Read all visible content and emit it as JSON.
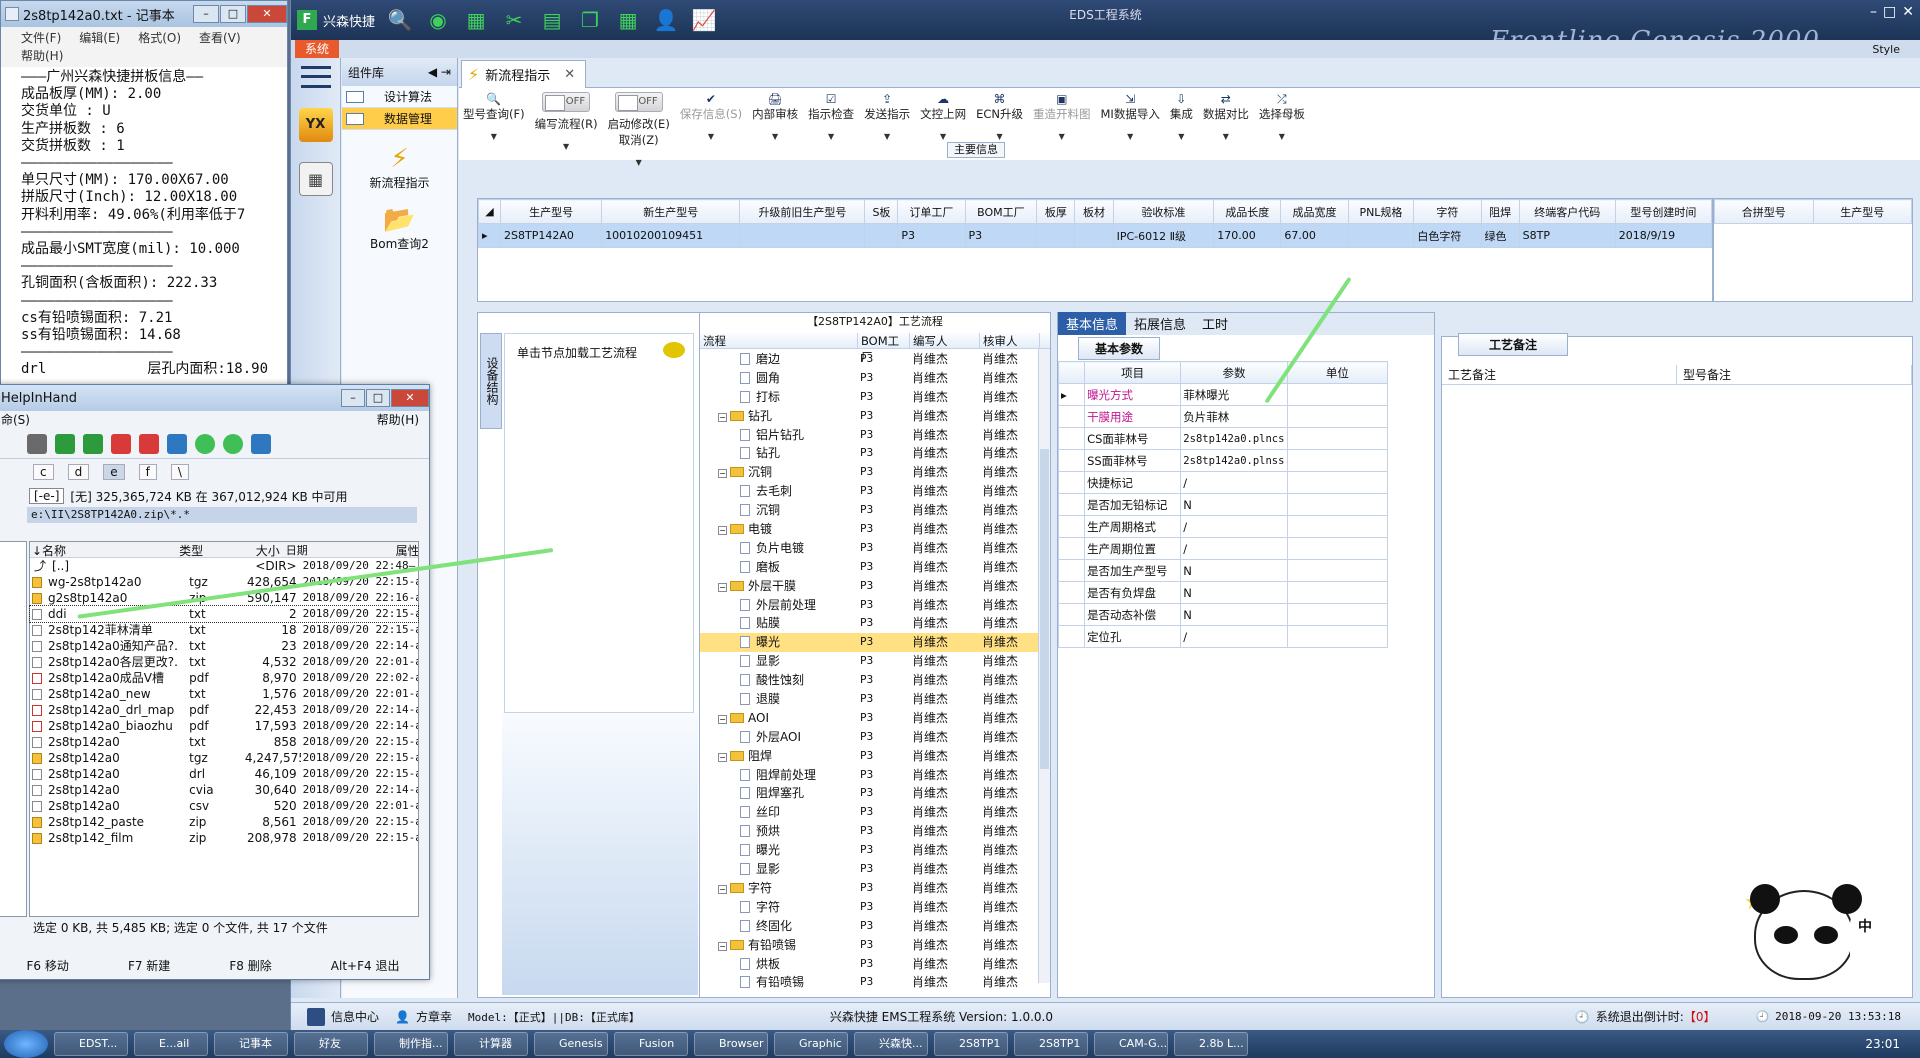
{
  "notepad": {
    "title": "2s8tp142a0.txt - 记事本",
    "menu": [
      "文件(F)",
      "编辑(E)",
      "格式(O)",
      "查看(V)",
      "帮助(H)"
    ],
    "lines": [
      "———广州兴森快捷拼板信息——",
      "成品板厚(MM): 2.00",
      "交货单位 : U",
      "生产拼板数 : 6",
      "交货拼板数 : 1",
      "——————————————————",
      "单只尺寸(MM): 170.00X67.00",
      "拼版尺寸(Inch): 12.00X18.00",
      "开料利用率: 49.06%(利用率低于7",
      "——————————————————",
      "成品最小SMT宽度(mil): 10.000",
      "——————————————————",
      "孔铜面积(含板面积): 222.33",
      "",
      "——————————————————",
      "cs有铅喷锡面积: 7.21",
      "ss有铅喷锡面积: 14.68",
      "——————————————————",
      "drl            层孔内面积:18.90"
    ]
  },
  "app": {
    "brand": "兴森快捷",
    "window_title": "EDS工程系统",
    "banner": "Frontline  Genesis 2000",
    "style_label": "Style",
    "system_tab": "系统",
    "quick_icons": [
      "search-icon",
      "globe-icon",
      "grid-icon",
      "scissors-icon",
      "film-icon",
      "copy-icon",
      "table-icon",
      "user-icon",
      "chart-icon"
    ]
  },
  "complib": {
    "title": "组件库",
    "items": [
      {
        "label": "设计算法"
      },
      {
        "label": "数据管理"
      }
    ],
    "big_items": [
      {
        "label": "新流程指示"
      },
      {
        "label": "Bom查询2"
      }
    ]
  },
  "doc_tab": {
    "label": "新流程指示"
  },
  "toolbar": {
    "buttons": [
      {
        "label": "型号查询(F)",
        "icon": "search-icon"
      },
      {
        "label": "编写流程(R)",
        "toggle": "OFF"
      },
      {
        "label": "启动修改(E)",
        "toggle": "OFF",
        "sub": "取消(Z)"
      },
      {
        "label": "保存信息(S)",
        "icon": "check-icon",
        "disabled": true
      },
      {
        "label": "内部审核",
        "icon": "printer-icon"
      },
      {
        "label": "指示检查",
        "icon": "checklist-icon"
      },
      {
        "label": "发送指示",
        "icon": "upload-icon"
      },
      {
        "label": "文控上网",
        "icon": "cloud-upload-icon"
      },
      {
        "label": "ECN升级",
        "icon": "binoculars-icon"
      },
      {
        "label": "重造开料图",
        "icon": "image-icon",
        "disabled": true
      },
      {
        "label": "MI数据导入",
        "icon": "import-icon"
      },
      {
        "label": "集成",
        "icon": "download-icon"
      },
      {
        "label": "数据对比",
        "icon": "compare-icon"
      },
      {
        "label": "选择母板",
        "icon": "shuffle-icon"
      }
    ]
  },
  "main_info": {
    "section_title": "主要信息",
    "columns": [
      "生产型号",
      "新生产型号",
      "升级前旧生产型号",
      "S板",
      "订单工厂",
      "BOM工厂",
      "板厚",
      "板材",
      "验收标准",
      "成品长度",
      "成品宽度",
      "PNL规格",
      "字符",
      "阻焊",
      "终端客户代码",
      "型号创建时间"
    ],
    "rows": [
      [
        "2S8TP142A0",
        "10010200109451",
        "",
        "",
        "P3",
        "P3",
        "",
        "",
        "IPC-6012 Ⅱ级",
        "170.00",
        "67.00",
        "",
        "白色字符",
        "绿色",
        "S8TP",
        "2018/9/19"
      ]
    ],
    "merge_columns": [
      "合拼型号",
      "生产型号"
    ]
  },
  "process": {
    "vtab": "设备结构",
    "hint": "单击节点加载工艺流程",
    "title": "【2S8TP142A0】工艺流程",
    "columns": [
      "流程",
      "BOM工厂",
      "编写人",
      "核审人"
    ],
    "rows": [
      {
        "name": "磨边",
        "level": 2,
        "bom": "P3",
        "writer": "肖维杰",
        "reviewer": "肖维杰"
      },
      {
        "name": "圆角",
        "level": 2,
        "bom": "P3",
        "writer": "肖维杰",
        "reviewer": "肖维杰"
      },
      {
        "name": "打标",
        "level": 2,
        "bom": "P3",
        "writer": "肖维杰",
        "reviewer": "肖维杰"
      },
      {
        "name": "钻孔",
        "level": 1,
        "bom": "P3",
        "writer": "肖维杰",
        "reviewer": "肖维杰"
      },
      {
        "name": "铝片钻孔",
        "level": 2,
        "bom": "P3",
        "writer": "肖维杰",
        "reviewer": "肖维杰"
      },
      {
        "name": "钻孔",
        "level": 2,
        "bom": "P3",
        "writer": "肖维杰",
        "reviewer": "肖维杰"
      },
      {
        "name": "沉铜",
        "level": 1,
        "bom": "P3",
        "writer": "肖维杰",
        "reviewer": "肖维杰"
      },
      {
        "name": "去毛刺",
        "level": 2,
        "bom": "P3",
        "writer": "肖维杰",
        "reviewer": "肖维杰"
      },
      {
        "name": "沉铜",
        "level": 2,
        "bom": "P3",
        "writer": "肖维杰",
        "reviewer": "肖维杰"
      },
      {
        "name": "电镀",
        "level": 1,
        "bom": "P3",
        "writer": "肖维杰",
        "reviewer": "肖维杰"
      },
      {
        "name": "负片电镀",
        "level": 2,
        "bom": "P3",
        "writer": "肖维杰",
        "reviewer": "肖维杰"
      },
      {
        "name": "磨板",
        "level": 2,
        "bom": "P3",
        "writer": "肖维杰",
        "reviewer": "肖维杰"
      },
      {
        "name": "外层干膜",
        "level": 1,
        "bom": "P3",
        "writer": "肖维杰",
        "reviewer": "肖维杰"
      },
      {
        "name": "外层前处理",
        "level": 2,
        "bom": "P3",
        "writer": "肖维杰",
        "reviewer": "肖维杰"
      },
      {
        "name": "贴膜",
        "level": 2,
        "bom": "P3",
        "writer": "肖维杰",
        "reviewer": "肖维杰"
      },
      {
        "name": "曝光",
        "level": 2,
        "bom": "P3",
        "writer": "肖维杰",
        "reviewer": "肖维杰",
        "selected": true
      },
      {
        "name": "显影",
        "level": 2,
        "bom": "P3",
        "writer": "肖维杰",
        "reviewer": "肖维杰"
      },
      {
        "name": "酸性蚀刻",
        "level": 2,
        "bom": "P3",
        "writer": "肖维杰",
        "reviewer": "肖维杰"
      },
      {
        "name": "退膜",
        "level": 2,
        "bom": "P3",
        "writer": "肖维杰",
        "reviewer": "肖维杰"
      },
      {
        "name": "AOI",
        "level": 1,
        "bom": "P3",
        "writer": "肖维杰",
        "reviewer": "肖维杰"
      },
      {
        "name": "外层AOI",
        "level": 2,
        "bom": "P3",
        "writer": "肖维杰",
        "reviewer": "肖维杰"
      },
      {
        "name": "阻焊",
        "level": 1,
        "bom": "P3",
        "writer": "肖维杰",
        "reviewer": "肖维杰"
      },
      {
        "name": "阻焊前处理",
        "level": 2,
        "bom": "P3",
        "writer": "肖维杰",
        "reviewer": "肖维杰"
      },
      {
        "name": "阻焊塞孔",
        "level": 2,
        "bom": "P3",
        "writer": "肖维杰",
        "reviewer": "肖维杰"
      },
      {
        "name": "丝印",
        "level": 2,
        "bom": "P3",
        "writer": "肖维杰",
        "reviewer": "肖维杰"
      },
      {
        "name": "预烘",
        "level": 2,
        "bom": "P3",
        "writer": "肖维杰",
        "reviewer": "肖维杰"
      },
      {
        "name": "曝光",
        "level": 2,
        "bom": "P3",
        "writer": "肖维杰",
        "reviewer": "肖维杰"
      },
      {
        "name": "显影",
        "level": 2,
        "bom": "P3",
        "writer": "肖维杰",
        "reviewer": "肖维杰"
      },
      {
        "name": "字符",
        "level": 1,
        "bom": "P3",
        "writer": "肖维杰",
        "reviewer": "肖维杰"
      },
      {
        "name": "字符",
        "level": 2,
        "bom": "P3",
        "writer": "肖维杰",
        "reviewer": "肖维杰"
      },
      {
        "name": "终固化",
        "level": 2,
        "bom": "P3",
        "writer": "肖维杰",
        "reviewer": "肖维杰"
      },
      {
        "name": "有铅喷锡",
        "level": 1,
        "bom": "P3",
        "writer": "肖维杰",
        "reviewer": "肖维杰"
      },
      {
        "name": "烘板",
        "level": 2,
        "bom": "P3",
        "writer": "肖维杰",
        "reviewer": "肖维杰"
      },
      {
        "name": "有铅喷锡",
        "level": 2,
        "bom": "P3",
        "writer": "肖维杰",
        "reviewer": "肖维杰"
      }
    ]
  },
  "basic": {
    "tabs": [
      "基本信息",
      "拓展信息",
      "工时"
    ],
    "sub_title": "基本参数",
    "columns": [
      "项目",
      "参数",
      "单位"
    ],
    "rows": [
      {
        "item": "曝光方式",
        "value": "菲林曝光",
        "hl": true
      },
      {
        "item": "干膜用途",
        "value": "负片菲林",
        "hl": true
      },
      {
        "item": "CS面菲林号",
        "value": "2s8tp142a0.plncs"
      },
      {
        "item": "SS面菲林号",
        "value": "2s8tp142a0.plnss"
      },
      {
        "item": "快捷标记",
        "value": "/"
      },
      {
        "item": "是否加无铅标记",
        "value": "N"
      },
      {
        "item": "生产周期格式",
        "value": "/"
      },
      {
        "item": "生产周期位置",
        "value": "/"
      },
      {
        "item": "是否加生产型号",
        "value": "N"
      },
      {
        "item": "是否有负焊盘",
        "value": "N"
      },
      {
        "item": "是否动态补偿",
        "value": "N"
      },
      {
        "item": "定位孔",
        "value": "/"
      }
    ]
  },
  "notes": {
    "title": "工艺备注",
    "columns": [
      "工艺备注",
      "型号备注"
    ]
  },
  "status": {
    "info_center": "信息中心",
    "user": "方章幸",
    "model": "Model:【正式】||DB:【正式库】",
    "system": "兴森快捷 EMS工程系统 Version: 1.0.0.0",
    "logout_label": "系统退出倒计时:",
    "logout_value": "【0】",
    "datetime": "2018-09-20 13:53:18"
  },
  "hih": {
    "title": "HelpInHand",
    "menu_left": "命(S)",
    "menu_right": "帮助(H)",
    "drives": [
      "c",
      "d",
      "e",
      "f",
      "\\"
    ],
    "drive_select": "[-e-]",
    "space": "[无] 325,365,724 KB 在 367,012,924 KB 中可用",
    "path": "e:\\II\\2S8TP142A0.zip\\*.*",
    "columns": [
      "↓名称",
      "类型",
      "大小",
      "日期",
      "属性"
    ],
    "files": [
      {
        "name": "[..]",
        "type": "",
        "size": "<DIR>",
        "date": "2018/09/20 22:48—",
        "kind": "up"
      },
      {
        "name": "wg-2s8tp142a0",
        "type": "tgz",
        "size": "428,654",
        "date": "2018/09/20 22:15-a—",
        "kind": "arc"
      },
      {
        "name": "g2s8tp142a0",
        "type": "zip",
        "size": "590,147",
        "date": "2018/09/20 22:16-a—",
        "kind": "arc"
      },
      {
        "name": "ddi",
        "type": "txt",
        "size": "2",
        "date": "2018/09/20 22:15-a—",
        "kind": "doc",
        "selected": true
      },
      {
        "name": "2s8tp142菲林清单",
        "type": "txt",
        "size": "18",
        "date": "2018/09/20 22:15-a—",
        "kind": "doc"
      },
      {
        "name": "2s8tp142a0通知产品?.",
        "type": "txt",
        "size": "23",
        "date": "2018/09/20 22:14-a—",
        "kind": "doc"
      },
      {
        "name": "2s8tp142a0各层更改?.",
        "type": "txt",
        "size": "4,532",
        "date": "2018/09/20 22:01-a—",
        "kind": "doc"
      },
      {
        "name": "2s8tp142a0成品V槽",
        "type": "pdf",
        "size": "8,970",
        "date": "2018/09/20 22:02-a—",
        "kind": "pdf"
      },
      {
        "name": "2s8tp142a0_new",
        "type": "txt",
        "size": "1,576",
        "date": "2018/09/20 22:01-a—",
        "kind": "doc"
      },
      {
        "name": "2s8tp142a0_drl_map",
        "type": "pdf",
        "size": "22,453",
        "date": "2018/09/20 22:14-a—",
        "kind": "pdf"
      },
      {
        "name": "2s8tp142a0_biaozhu",
        "type": "pdf",
        "size": "17,593",
        "date": "2018/09/20 22:14-a—",
        "kind": "pdf"
      },
      {
        "name": "2s8tp142a0",
        "type": "txt",
        "size": "858",
        "date": "2018/09/20 22:15-a—",
        "kind": "doc"
      },
      {
        "name": "2s8tp142a0",
        "type": "tgz",
        "size": "4,247,575",
        "date": "2018/09/20 22:15-a—",
        "kind": "arc"
      },
      {
        "name": "2s8tp142a0",
        "type": "drl",
        "size": "46,109",
        "date": "2018/09/20 22:15-a—",
        "kind": "doc"
      },
      {
        "name": "2s8tp142a0",
        "type": "cvia",
        "size": "30,640",
        "date": "2018/09/20 22:14-a—",
        "kind": "doc"
      },
      {
        "name": "2s8tp142a0",
        "type": "csv",
        "size": "520",
        "date": "2018/09/20 22:01-a—",
        "kind": "doc"
      },
      {
        "name": "2s8tp142_paste",
        "type": "zip",
        "size": "8,561",
        "date": "2018/09/20 22:15-a—",
        "kind": "arc"
      },
      {
        "name": "2s8tp142_film",
        "type": "zip",
        "size": "208,978",
        "date": "2018/09/20 22:15-a—",
        "kind": "arc"
      }
    ],
    "footer": "选定 0 KB, 共 5,485 KB; 选定 0 个文件, 共 17 个文件",
    "fkeys": [
      "F6 移动",
      "F7 新建",
      "F8 删除",
      "Alt+F4 退出"
    ]
  },
  "taskbar": {
    "tasks": [
      "EDST...",
      "E...ail",
      "记事本",
      "好友",
      "制作指...",
      "计算器",
      "Genesis",
      "Fusion",
      "Browser",
      "Graphic",
      "兴森快...",
      "2S8TP1",
      "2S8TP1",
      "CAM-G...",
      "2.8b L..."
    ],
    "clock": "23:01"
  },
  "panda_side_text": "中"
}
